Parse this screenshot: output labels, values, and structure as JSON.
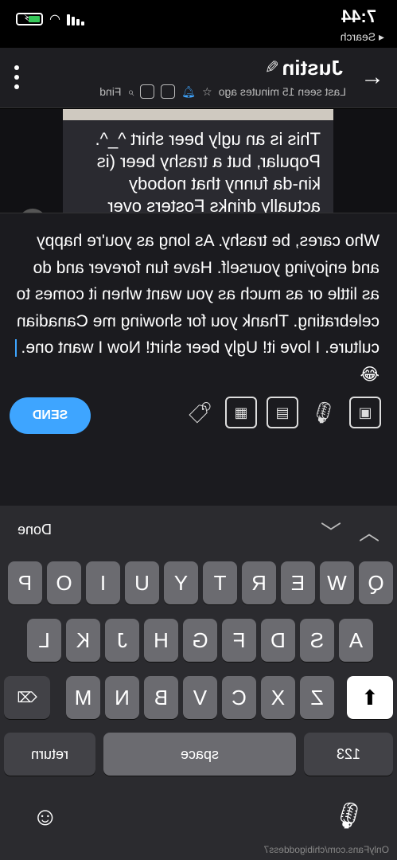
{
  "status": {
    "time": "7:44",
    "back_label": "◂ Search"
  },
  "header": {
    "name": "Justin",
    "last_seen": "Last seen 15 minutes ago",
    "find_label": "Find"
  },
  "chat": {
    "bubble_text": "This is an ugly beer shirt ^_^. Popular, but a trashy beer (is kin-da funny that nobody actually drinks Fosters over here, unlike"
  },
  "composer": {
    "text": "Who cares, be trashy. As long as you're happy and enjoying yourself. Have fun forever and do as little or as much as you want when it comes to celebrating. Thank you for showing me Canadian culture. I love it! Ugly beer shirt! Now I want one. ",
    "emoji": "😂",
    "send_label": "SEND"
  },
  "keyboard": {
    "done_label": "Done",
    "row1": [
      "Q",
      "W",
      "E",
      "R",
      "T",
      "Y",
      "U",
      "I",
      "O",
      "P"
    ],
    "row2": [
      "A",
      "S",
      "D",
      "F",
      "G",
      "H",
      "J",
      "K",
      "L"
    ],
    "row3": [
      "Z",
      "X",
      "C",
      "V",
      "B",
      "N",
      "M"
    ],
    "numbers_label": "123",
    "space_label": "space",
    "return_label": "return",
    "watermark": "OnlyFans.com/chibigoddess7"
  },
  "colors": {
    "accent": "#3ea5ff",
    "send": "#3ea5ff",
    "battery": "#36c759"
  }
}
